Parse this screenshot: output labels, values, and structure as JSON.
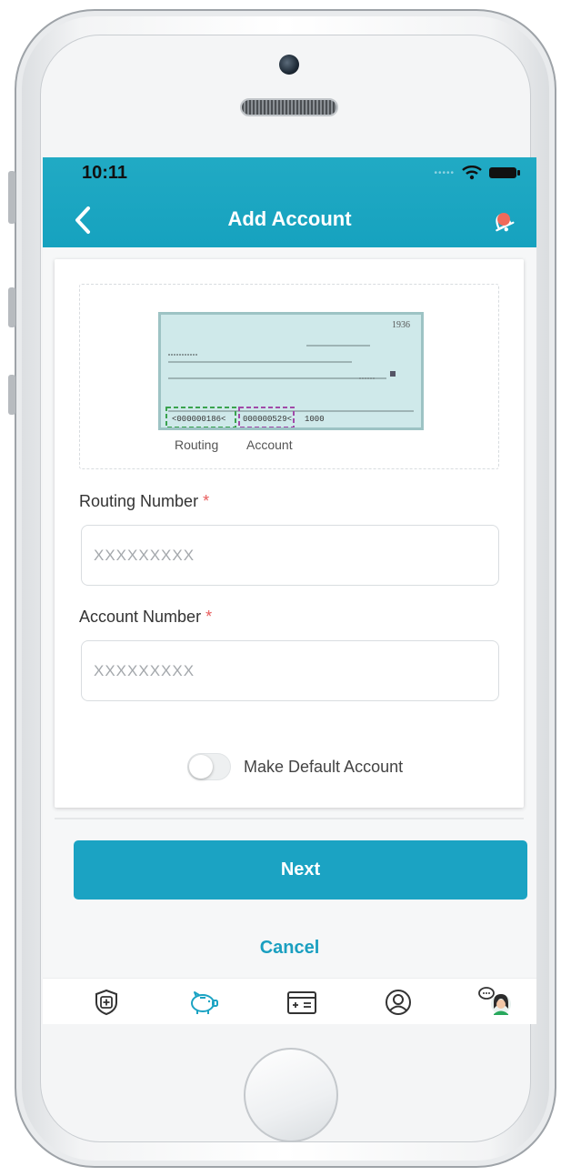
{
  "status_bar": {
    "time": "10:11"
  },
  "header": {
    "title": "Add Account"
  },
  "check_image": {
    "number": "1936",
    "micr_routing": "<000000186<",
    "micr_account": "000000529<",
    "micr_check": "1000",
    "routing_label": "Routing",
    "account_label": "Account"
  },
  "form": {
    "routing": {
      "label": "Routing Number",
      "required_mark": "*",
      "placeholder": "XXXXXXXXX"
    },
    "account": {
      "label": "Account Number",
      "required_mark": "*",
      "placeholder": "XXXXXXXXX"
    },
    "default_toggle": {
      "label": "Make Default Account",
      "on": false
    }
  },
  "actions": {
    "next_label": "Next",
    "cancel_label": "Cancel"
  },
  "tabbar": {
    "icons": [
      "shield-plus-icon",
      "piggy-bank-icon",
      "bill-calculator-icon",
      "profile-icon",
      "chat-agent-icon"
    ],
    "active_index": 1
  },
  "colors": {
    "brand": "#1ba3c3",
    "required": "#e85c5c",
    "bell_accent": "#f06a5a"
  }
}
